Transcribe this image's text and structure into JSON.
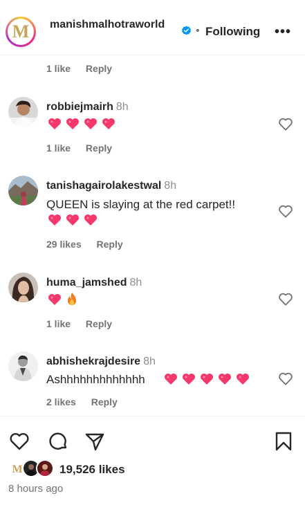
{
  "header": {
    "username": "manishmalhotraworld",
    "logo_letter": "M",
    "separator": "•",
    "follow_state": "Following",
    "more": "•••"
  },
  "prev_comment": {
    "likes": "1 like",
    "reply": "Reply"
  },
  "comments": [
    {
      "username": "robbiejmairh",
      "time": "8h",
      "text": "",
      "likes": "1 like",
      "reply": "Reply"
    },
    {
      "username": "tanishagairolakestwal",
      "time": "8h",
      "text": "QUEEN is slaying at the red carpet!!",
      "likes": "29 likes",
      "reply": "Reply"
    },
    {
      "username": "huma_jamshed",
      "time": "8h",
      "text": "",
      "likes": "1 like",
      "reply": "Reply"
    },
    {
      "username": "abhishekrajdesire",
      "time": "8h",
      "text": "Ashhhhhhhhhhhhh",
      "likes": "2 likes",
      "reply": "Reply"
    }
  ],
  "post": {
    "likes_count": "19,526 likes",
    "posted": "8 hours ago"
  },
  "colors": {
    "text": "#262626",
    "muted": "#737373",
    "verified": "#0095f6",
    "heart_emoji": "#f5386b"
  }
}
